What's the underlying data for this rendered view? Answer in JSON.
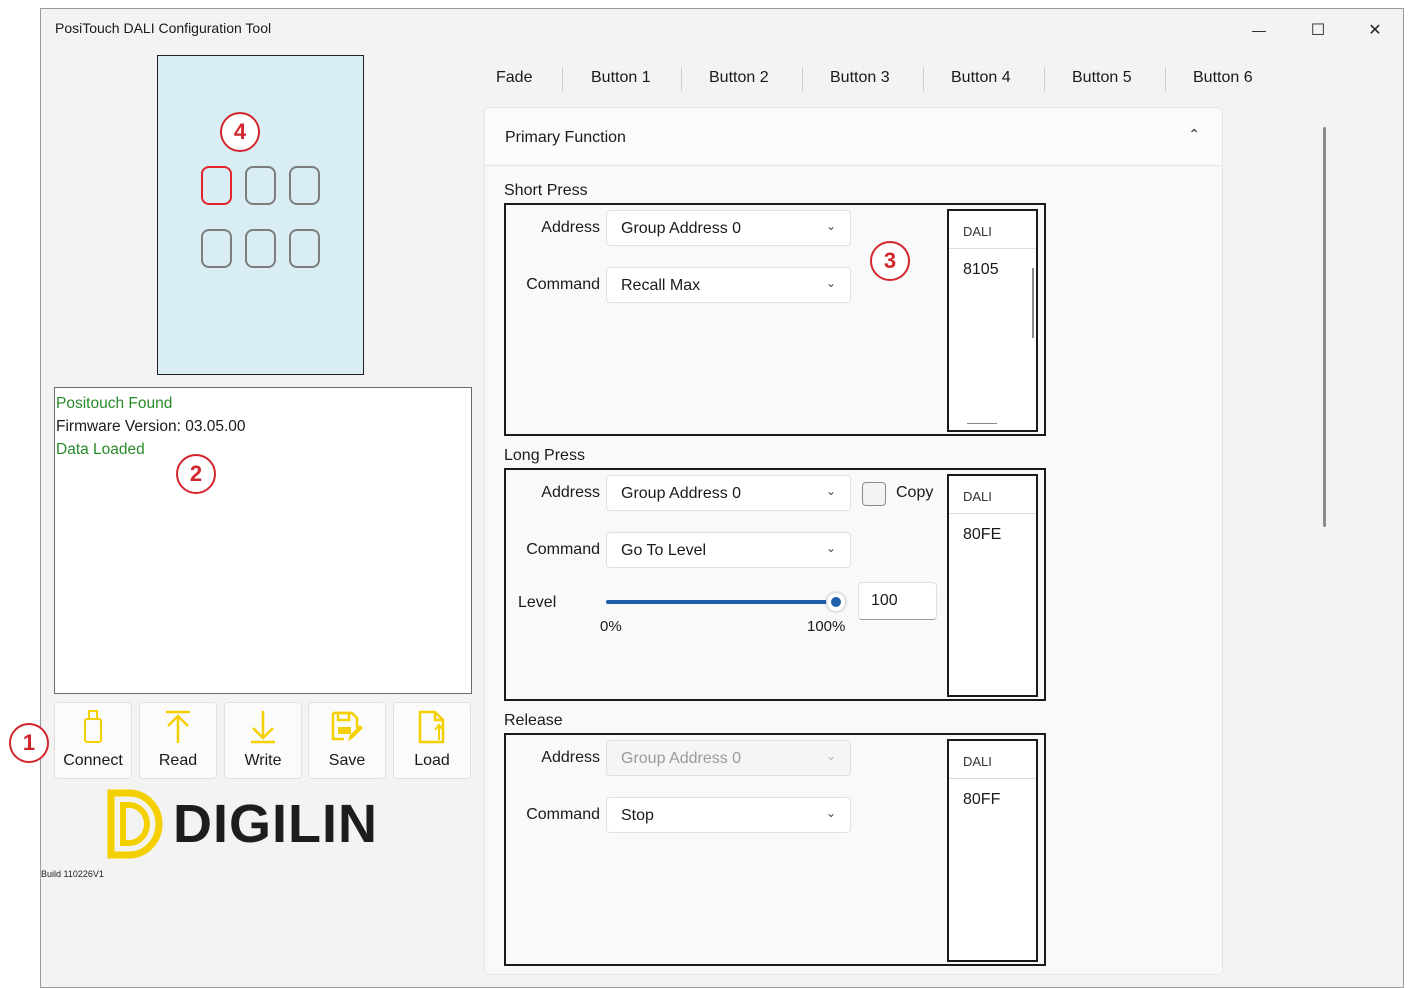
{
  "window": {
    "title": "PosiTouch DALI Configuration Tool",
    "minimize_glyph": "—",
    "maximize_glyph": "☐",
    "close_glyph": "✕"
  },
  "callouts": [
    "1",
    "2",
    "3",
    "4"
  ],
  "status_log": {
    "lines": [
      {
        "text": "Positouch Found",
        "color": "#2a8a2a"
      },
      {
        "text": "Firmware Version: 03.05.00",
        "color": "#1a1a1a"
      },
      {
        "text": "Data Loaded",
        "color": "#2a8a2a"
      }
    ]
  },
  "toolbar": {
    "connect": "Connect",
    "read": "Read",
    "write": "Write",
    "save": "Save",
    "load": "Load",
    "icon_color": "#f5d000"
  },
  "brand": {
    "name": "DIGILIN",
    "build": "Build 110226V1",
    "accent": "#f5d000"
  },
  "tabs": [
    "Fade",
    "Button 1",
    "Button 2",
    "Button 3",
    "Button 4",
    "Button 5",
    "Button 6"
  ],
  "selected_tab": "Button 1",
  "primary_function": {
    "header": "Primary Function",
    "short_press": {
      "label": "Short Press",
      "address_label": "Address",
      "address_value": "Group Address 0",
      "command_label": "Command",
      "command_value": "Recall Max",
      "dali_header": "DALI",
      "dali_value": "8105"
    },
    "long_press": {
      "label": "Long Press",
      "address_label": "Address",
      "address_value": "Group Address 0",
      "copy_label": "Copy",
      "copy_checked": false,
      "command_label": "Command",
      "command_value": "Go To Level",
      "level_label": "Level",
      "level_value": "100",
      "level_fraction": 1.0,
      "slider_min": "0%",
      "slider_max": "100%",
      "dali_header": "DALI",
      "dali_value": "80FE"
    },
    "release": {
      "label": "Release",
      "address_label": "Address",
      "address_value": "Group Address 0",
      "address_disabled": true,
      "command_label": "Command",
      "command_value": "Stop",
      "dali_header": "DALI",
      "dali_value": "80FF"
    }
  },
  "colors": {
    "accent": "#1e5fa8",
    "callout": "#d0262c",
    "device_panel": "#d8edf4",
    "selected_key": "#e3242b"
  }
}
